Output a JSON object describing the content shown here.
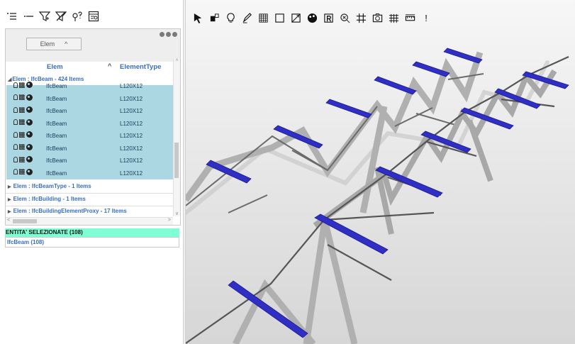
{
  "left_toolbar": {
    "icons": [
      "list-indent-icon",
      "collapse-icon",
      "filter-icon",
      "clear-filter-icon",
      "help-search-icon",
      "report-icon"
    ]
  },
  "tree": {
    "group_by_chip": "Elem",
    "columns": {
      "elem": "Elem",
      "element_type": "ElementType"
    },
    "expanded_group": "Elem : IfcBeam - 424 Items",
    "rows": [
      {
        "name": "IfcBeam",
        "type": "L120X12"
      },
      {
        "name": "IfcBeam",
        "type": "L120X12"
      },
      {
        "name": "IfcBeam",
        "type": "L120X12"
      },
      {
        "name": "IfcBeam",
        "type": "L120X12"
      },
      {
        "name": "IfcBeam",
        "type": "L120X12"
      },
      {
        "name": "IfcBeam",
        "type": "L120X12"
      },
      {
        "name": "IfcBeam",
        "type": "L120X12"
      },
      {
        "name": "IfcBeam",
        "type": "L120X12"
      }
    ],
    "collapsed_groups": [
      "Elem : IfcBeamType - 1 Items",
      "Elem : IfcBuilding - 1 Items",
      "Elem : IfcBuildingElementProxy - 17 Items"
    ]
  },
  "selection": {
    "header": "ENTITA' SELEZIONATE (108)",
    "items": [
      "IfcBeam (108)"
    ]
  },
  "viewer_toolbar": {
    "icons": [
      "select-arrow-icon",
      "select-box-icon",
      "bulb-icon",
      "pen-icon",
      "grid-pattern-icon",
      "square-icon",
      "section-icon",
      "paint-icon",
      "reset-icon",
      "zoom-icon",
      "hash-icon",
      "camera-icon",
      "table-icon",
      "measure-icon",
      "exclamation-icon"
    ],
    "last_label": "!"
  },
  "colors": {
    "selection_row": "#abd7e3",
    "selection_header": "#7fffd4",
    "link_text": "#3a6ec2",
    "beam_selected": "#2e2ec4",
    "beam_grey": "#a8a8a8",
    "beam_dark": "#5a5a5a"
  }
}
